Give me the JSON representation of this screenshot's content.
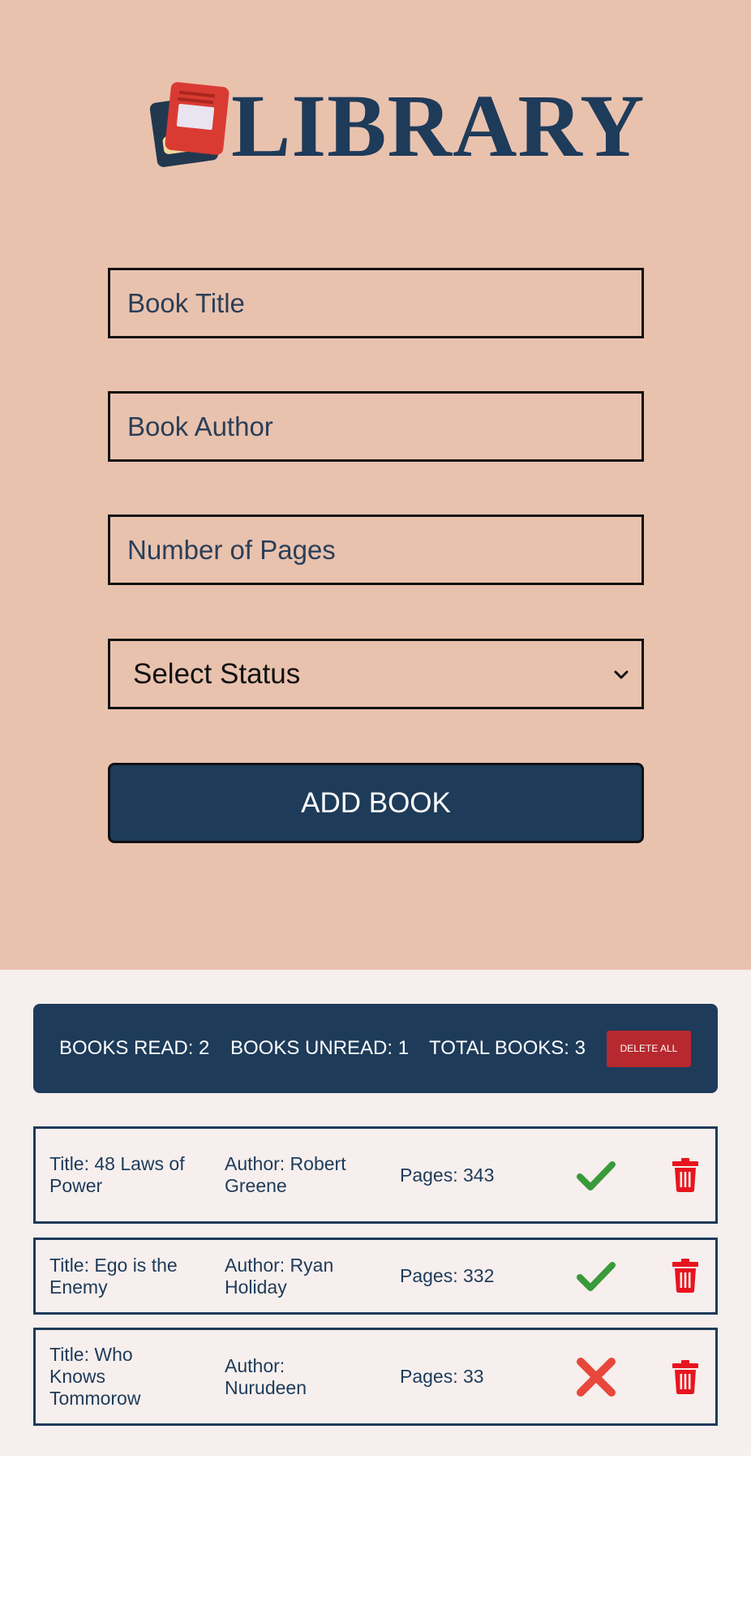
{
  "header": {
    "title": "LIBRARY",
    "logo_icon": "book-stack-icon"
  },
  "form": {
    "title_placeholder": "Book Title",
    "author_placeholder": "Book Author",
    "pages_placeholder": "Number of Pages",
    "status_select": "Select Status",
    "add_button": "ADD BOOK"
  },
  "stats": {
    "read": "BOOKS READ: 2",
    "unread": "BOOKS UNREAD: 1",
    "total": "TOTAL BOOKS: 3",
    "delete_all": "DELETE ALL"
  },
  "books": [
    {
      "title": "Title: 48 Laws of Power",
      "author": "Author: Robert Greene",
      "pages": "Pages: 343",
      "status_icon": "checkmark-icon",
      "read": true
    },
    {
      "title": "Title: Ego is the Enemy",
      "author": "Author: Ryan Holiday",
      "pages": "Pages: 332",
      "status_icon": "checkmark-icon",
      "read": true
    },
    {
      "title": "Title: Who Knows Tommorow",
      "author": "Author: Nurudeen",
      "pages": "Pages: 33",
      "status_icon": "x-mark-icon",
      "read": false
    }
  ],
  "colors": {
    "top_background": "#e9c2ae",
    "navy": "#1e3b5a",
    "list_background": "#f6efed",
    "delete_red": "#b7292f",
    "check_green": "#3a9a3a",
    "x_red": "#e8473c",
    "trash_red": "#e8141e"
  }
}
